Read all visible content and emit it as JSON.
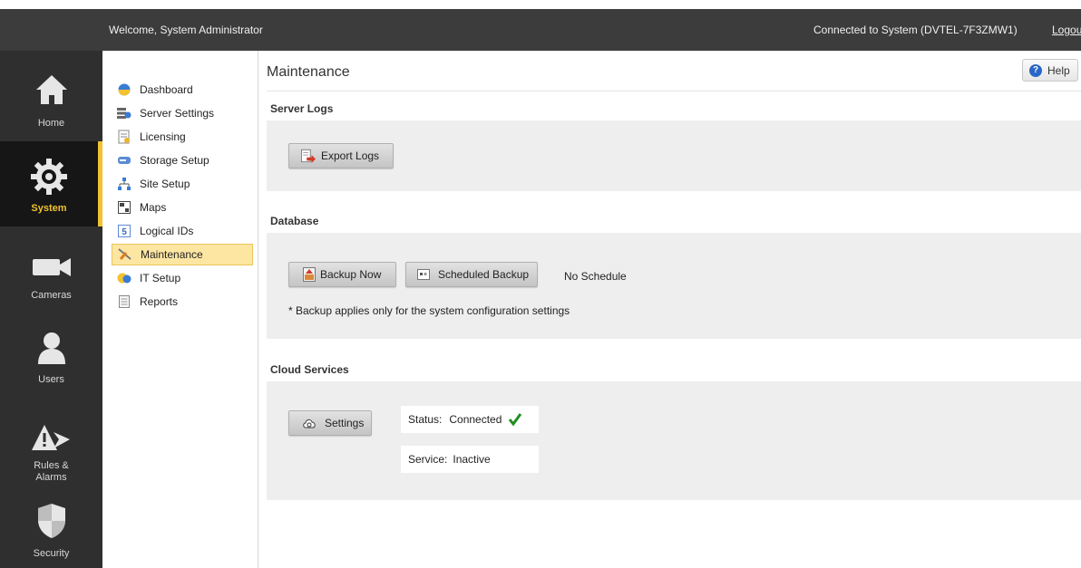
{
  "topbar": {
    "welcome": "Welcome, System Administrator",
    "connection": "Connected to System (DVTEL-7F3ZMW1)",
    "logout": "Logout"
  },
  "leftnav": {
    "items": [
      {
        "label": "Home",
        "icon": "home-icon",
        "active": false
      },
      {
        "label": "System",
        "icon": "gear-icon",
        "active": true
      },
      {
        "label": "Cameras",
        "icon": "camera-icon",
        "active": false
      },
      {
        "label": "Users",
        "icon": "user-icon",
        "active": false
      },
      {
        "label": "Rules &\nAlarms",
        "icon": "alarm-icon",
        "active": false
      },
      {
        "label": "Security",
        "icon": "shield-icon",
        "active": false
      }
    ]
  },
  "sidebar": {
    "items": [
      {
        "label": "Dashboard",
        "icon": "dashboard-icon"
      },
      {
        "label": "Server Settings",
        "icon": "server-settings-icon"
      },
      {
        "label": "Licensing",
        "icon": "licensing-icon"
      },
      {
        "label": "Storage Setup",
        "icon": "storage-icon"
      },
      {
        "label": "Site Setup",
        "icon": "site-icon"
      },
      {
        "label": "Maps",
        "icon": "maps-icon"
      },
      {
        "label": "Logical IDs",
        "icon": "logical-ids-icon"
      },
      {
        "label": "Maintenance",
        "icon": "maintenance-icon",
        "active": true
      },
      {
        "label": "IT Setup",
        "icon": "it-setup-icon"
      },
      {
        "label": "Reports",
        "icon": "reports-icon"
      }
    ]
  },
  "main": {
    "title": "Maintenance",
    "help_label": "Help",
    "server_logs": {
      "heading": "Server Logs",
      "export_label": "Export Logs"
    },
    "database": {
      "heading": "Database",
      "backup_now_label": "Backup Now",
      "scheduled_backup_label": "Scheduled Backup",
      "schedule_status": "No Schedule",
      "note": "* Backup applies only for the system configuration settings"
    },
    "cloud": {
      "heading": "Cloud Services",
      "settings_label": "Settings",
      "status_label": "Status:",
      "status_value": "Connected",
      "service_label": "Service:",
      "service_value": "Inactive"
    }
  },
  "colors": {
    "topbar": "#3c3c3c",
    "leftnav": "#2f2f2f",
    "accent": "#f1c232",
    "panel": "#eeeeee",
    "selected": "#fde6a2",
    "success": "#1f8f1f"
  }
}
